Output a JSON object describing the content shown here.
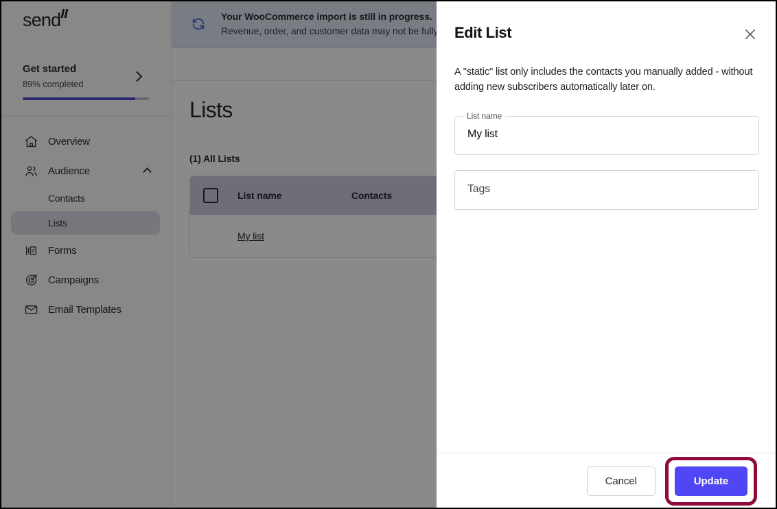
{
  "app": {
    "logo_text": "send"
  },
  "sidebar": {
    "get_started": {
      "title": "Get started",
      "progress_text": "89% completed",
      "progress_percent": 89,
      "chevron_icon": "chevron-right-icon"
    },
    "items": [
      {
        "label": "Overview",
        "icon": "home-icon",
        "active": false
      },
      {
        "label": "Audience",
        "icon": "users-icon",
        "active": false,
        "expanded": true,
        "chevron_icon": "chevron-up-icon"
      },
      {
        "label": "Forms",
        "icon": "form-icon",
        "active": false
      },
      {
        "label": "Campaigns",
        "icon": "target-icon",
        "active": false
      },
      {
        "label": "Email Templates",
        "icon": "envelope-icon",
        "active": false
      }
    ],
    "sub_items": [
      {
        "label": "Contacts",
        "active": false
      },
      {
        "label": "Lists",
        "active": true
      }
    ]
  },
  "banner": {
    "icon": "sync-icon",
    "line1": "Your WooCommerce import is still in progress.",
    "line2": "Revenue, order, and customer data may not be fully a"
  },
  "main": {
    "page_title": "Lists",
    "all_lists_label": "(1) All Lists",
    "table": {
      "columns": [
        "List name",
        "Contacts"
      ],
      "select_all_checkbox": "select-all-checkbox",
      "rows": [
        {
          "list_name": "My list",
          "contacts": ""
        }
      ]
    }
  },
  "modal": {
    "title": "Edit List",
    "close_icon": "close-icon",
    "description": "A \"static\" list only includes the contacts you manually added - without adding new subscribers automatically later on.",
    "fields": [
      {
        "legend": "List name",
        "value": "My list",
        "placeholder": ""
      },
      {
        "legend": "",
        "value": "",
        "placeholder": "Tags"
      }
    ],
    "cancel_label": "Cancel",
    "update_label": "Update"
  },
  "colors": {
    "accent_indigo": "#4f46f5",
    "progress_indigo": "#3d3dc4",
    "highlight_ring": "#8f0a3f",
    "banner_bg": "#dfe3f0",
    "banner_icon": "#2f5ccd",
    "table_header_bg": "#c6c6d8",
    "sidebar_active_bg": "#d9d9e4"
  }
}
